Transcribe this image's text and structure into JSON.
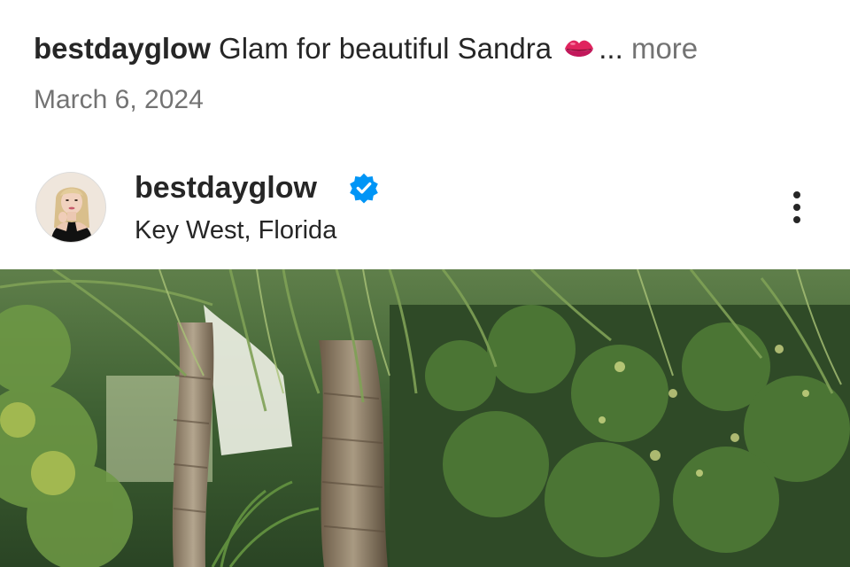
{
  "caption": {
    "username": "bestdayglow",
    "text": "Glam for beautiful Sandra",
    "emoji_icon": "kiss-mark-icon",
    "ellipsis": "...",
    "more_label": "more"
  },
  "post_date": "March 6, 2024",
  "post_header": {
    "username": "bestdayglow",
    "verified": true,
    "location": "Key West, Florida",
    "more_options_icon": "three-dots-vertical-icon"
  },
  "colors": {
    "text_primary": "#262626",
    "text_secondary": "#737373",
    "verified_blue": "#0095f6",
    "lips_pink": "#e0245e"
  }
}
